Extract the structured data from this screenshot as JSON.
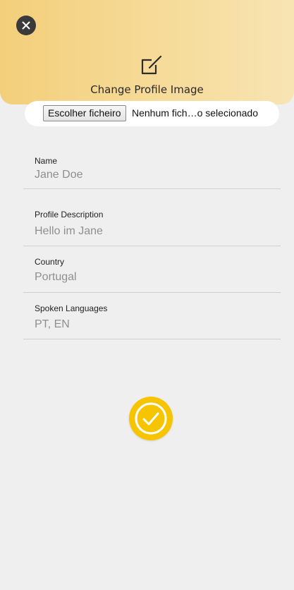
{
  "header": {
    "close_icon": "close-icon",
    "edit_icon": "edit-square-icon",
    "change_profile_label": "Change Profile Image"
  },
  "file_picker": {
    "button_label": "Escolher ficheiro",
    "status_text": "Nenhum fich…o selecionado"
  },
  "form": {
    "name": {
      "label": "Name",
      "value": "Jane Doe"
    },
    "description": {
      "label": "Profile Description",
      "value": "Hello im Jane"
    },
    "country": {
      "label": "Country",
      "value": "Portugal"
    },
    "languages": {
      "label": "Spoken Languages",
      "value": "PT, EN"
    }
  },
  "confirm": {
    "icon": "check-circle-icon"
  },
  "colors": {
    "header_gradient_start": "#f3cf7a",
    "header_gradient_end": "#f8e4b3",
    "accent_yellow": "#f6c500",
    "background": "#efefef"
  }
}
